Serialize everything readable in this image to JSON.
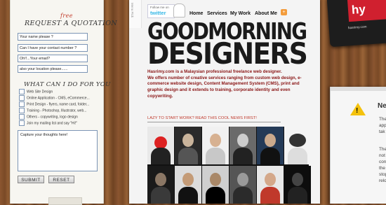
{
  "form": {
    "title": "REQUEST A QUOTATION",
    "title_free": "free",
    "fields": [
      {
        "value": "Your name please ?"
      },
      {
        "value": "Can I have your contact number ?"
      },
      {
        "value": "Oh!!...Your email?"
      },
      {
        "value": "also your location please......"
      }
    ],
    "services_title": "WHAT CAN I DO FOR YOU",
    "services": [
      "Web Site Design",
      "Online Application - CMS, eCommerce...",
      "Print Design - flyers, name card, folder...",
      "Training - Photoshop, Illustrator, web...",
      "Others - copywriting, logo design",
      "Join my mailing list and say \"Hi!\""
    ],
    "message_value": "Capture your thoughts here!",
    "submit_label": "SUBMIT",
    "reset_label": "RESET"
  },
  "header": {
    "hanger_text": "Menu Pick",
    "twitter_follow": "Follow me on",
    "twitter_name": "twitter",
    "nav": [
      "Home",
      "Services",
      "My Work",
      "About Me"
    ]
  },
  "hero": {
    "line1": "GOODMORNING",
    "line2": "DESIGNERS"
  },
  "intro": "Hasrimy.com is a Malaysian professional freelance web designer.\nWe offers number of creative services ranging from custom web design, e-commerce website design, Content Management System (CMS), print and graphic design and it extends to training, corporate identity and even copywriting.",
  "news_link": "LAZY TO START WORK? READ THIS COOL NEWS FIRST!",
  "right_card": {
    "logo_text": "hy",
    "url_text": "hasrimy.com"
  },
  "dialog": {
    "title": "Ne",
    "text_lines": [
      "The",
      "app",
      "tak",
      "",
      "The",
      "not",
      "con",
      "the",
      "stop",
      "relo"
    ]
  },
  "colors": {
    "accent_red": "#c0392b",
    "intro_text": "#8a1515",
    "field_border": "#7c95b5"
  }
}
